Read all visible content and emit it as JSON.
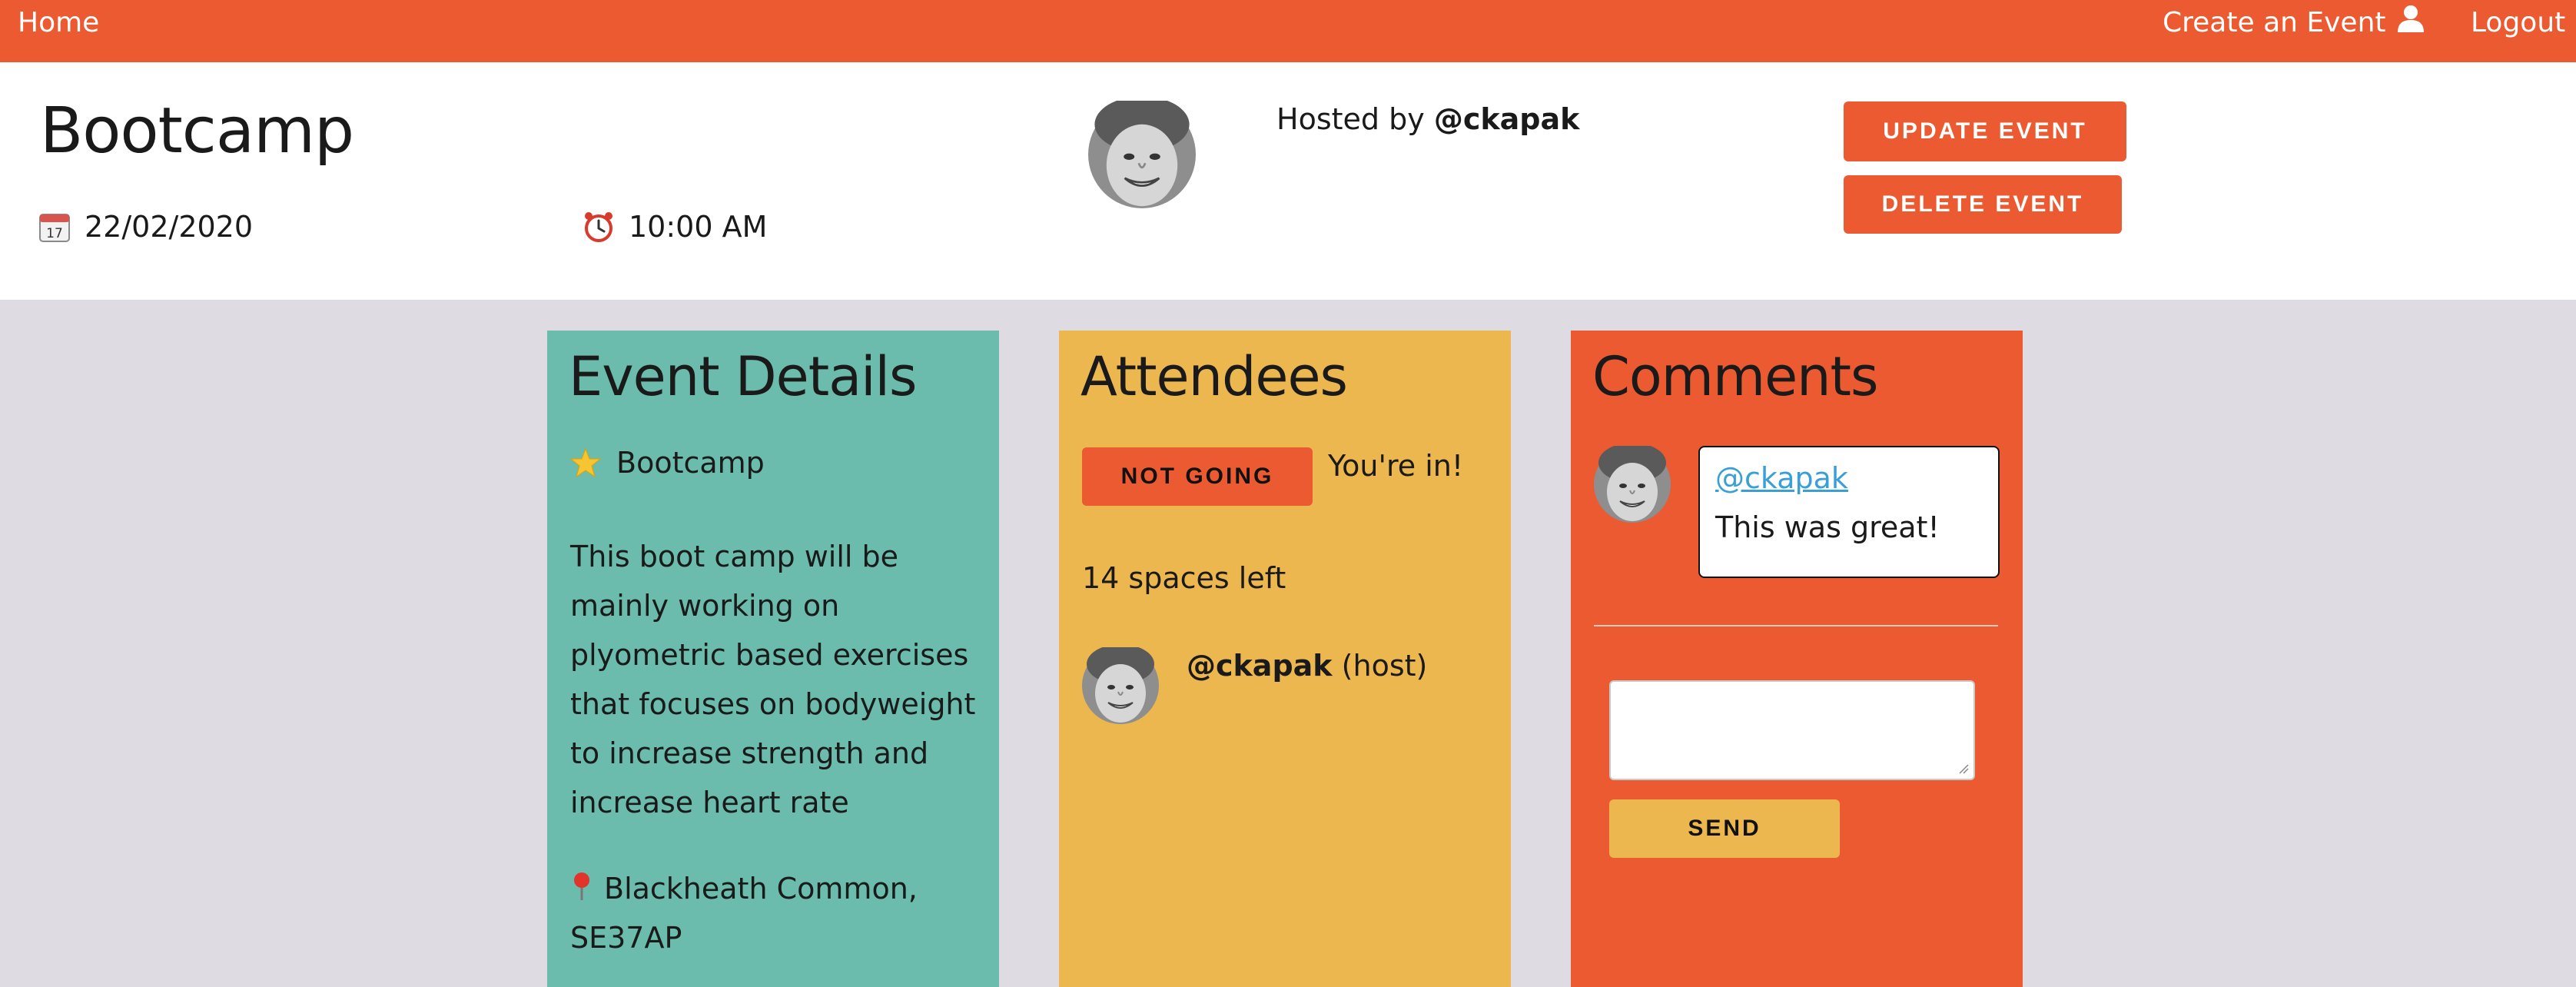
{
  "nav": {
    "home": "Home",
    "create_event": "Create an Event",
    "user_icon": "user-icon",
    "logout": "Logout"
  },
  "event": {
    "title": "Bootcamp",
    "date": "22/02/2020",
    "time": "10:00 AM",
    "hosted_prefix": "Hosted by",
    "host_handle": "@ckapak",
    "actions": {
      "update": "UPDATE EVENT",
      "delete": "DELETE EVENT"
    }
  },
  "details": {
    "heading": "Event Details",
    "name": "Bootcamp",
    "description": "This boot camp will be mainly working on plyometric based exercises that focuses on bodyweight to increase strength and increase heart rate",
    "location": "Blackheath Common, SE37AP"
  },
  "attendees": {
    "heading": "Attendees",
    "rsvp_button": "NOT GOING",
    "status": "You're in!",
    "spaces": "14 spaces left",
    "list": [
      {
        "handle": "@ckapak",
        "role": "(host)"
      }
    ]
  },
  "comments": {
    "heading": "Comments",
    "items": [
      {
        "user": "@ckapak",
        "text": "This was great!"
      }
    ],
    "input_value": "",
    "send": "SEND"
  },
  "colors": {
    "orange": "#eb5a30",
    "teal": "#6bbcad",
    "yellow": "#ecb74e",
    "background": "#dedbe3"
  }
}
